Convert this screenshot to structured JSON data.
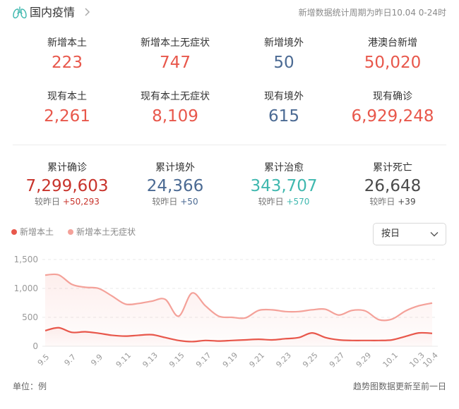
{
  "header": {
    "title": "国内疫情",
    "period": "新增数据统计周期为昨日10.04 0-24时"
  },
  "stats_row1": [
    {
      "label": "新增本土",
      "value": "223",
      "color": "#e8574b"
    },
    {
      "label": "新增本土无症状",
      "value": "747",
      "color": "#e8574b"
    },
    {
      "label": "新增境外",
      "value": "50",
      "color": "#4b6a93"
    },
    {
      "label": "港澳台新增",
      "value": "50,020",
      "color": "#e8574b"
    }
  ],
  "stats_row2": [
    {
      "label": "现有本土",
      "value": "2,261",
      "color": "#e8574b"
    },
    {
      "label": "现有本土无症状",
      "value": "8,109",
      "color": "#e8574b"
    },
    {
      "label": "现有境外",
      "value": "615",
      "color": "#4b6a93"
    },
    {
      "label": "现有确诊",
      "value": "6,929,248",
      "color": "#e8574b"
    }
  ],
  "stats_cumulative": [
    {
      "label": "累计确诊",
      "value": "7,299,603",
      "compare_label": "较昨日",
      "compare_value": "+50,293",
      "color": "#c8332b"
    },
    {
      "label": "累计境外",
      "value": "24,366",
      "compare_label": "较昨日",
      "compare_value": "+50",
      "color": "#4b6a93"
    },
    {
      "label": "累计治愈",
      "value": "343,707",
      "compare_label": "较昨日",
      "compare_value": "+570",
      "color": "#3fb8af"
    },
    {
      "label": "累计死亡",
      "value": "26,648",
      "compare_label": "较昨日",
      "compare_value": "+39",
      "color": "#4a4a4a"
    }
  ],
  "dropdown": {
    "selected": "按日"
  },
  "footer": {
    "unit": "单位：例",
    "note": "趋势图数据更新至前一日"
  },
  "chart_data": {
    "type": "line",
    "x": [
      "9.5",
      "9.6",
      "9.7",
      "9.8",
      "9.9",
      "9.10",
      "9.11",
      "9.12",
      "9.13",
      "9.14",
      "9.15",
      "9.16",
      "9.17",
      "9.18",
      "9.19",
      "9.20",
      "9.21",
      "9.22",
      "9.23",
      "9.24",
      "9.25",
      "9.26",
      "9.27",
      "9.28",
      "9.29",
      "9.30",
      "10.1",
      "10.2",
      "10.3",
      "10.4"
    ],
    "xtick_labels": [
      "9.5",
      "9.7",
      "9.9",
      "9.11",
      "9.13",
      "9.15",
      "9.17",
      "9.19",
      "9.21",
      "9.23",
      "9.25",
      "9.27",
      "9.29",
      "10.1",
      "10.3",
      "10.4"
    ],
    "series": [
      {
        "name": "新增本土",
        "color": "#e8574b",
        "values": [
          270,
          320,
          240,
          250,
          225,
          190,
          175,
          190,
          200,
          150,
          100,
          80,
          100,
          90,
          100,
          110,
          120,
          110,
          130,
          150,
          230,
          150,
          110,
          100,
          100,
          100,
          110,
          170,
          230,
          223
        ]
      },
      {
        "name": "新增本土无症状",
        "color": "#f4a199",
        "values": [
          1230,
          1235,
          1070,
          1020,
          1000,
          870,
          730,
          740,
          780,
          810,
          520,
          920,
          700,
          520,
          500,
          490,
          620,
          630,
          600,
          600,
          630,
          640,
          540,
          620,
          610,
          460,
          470,
          610,
          700,
          747
        ]
      }
    ],
    "ylim": [
      0,
      1500
    ],
    "yticks": [
      0,
      500,
      1000,
      1500
    ],
    "ytick_labels": [
      "0",
      "500",
      "1,000",
      "1,500"
    ],
    "grid": true,
    "legend": "top-left"
  }
}
